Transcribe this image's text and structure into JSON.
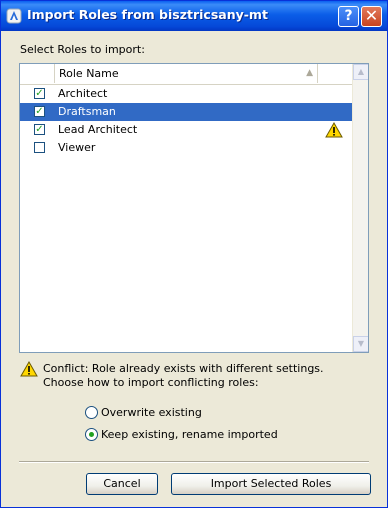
{
  "window": {
    "title": "Import Roles from bisztricsany-mt",
    "help_label": "?",
    "close_label": "✕"
  },
  "prompt": "Select Roles to import:",
  "table": {
    "header": "Role Name",
    "rows": [
      {
        "name": "Architect",
        "checked": true,
        "selected": false,
        "warning": false,
        "check_glyph": "✓"
      },
      {
        "name": "Draftsman",
        "checked": true,
        "selected": true,
        "warning": false,
        "check_glyph": "✓"
      },
      {
        "name": "Lead Architect",
        "checked": true,
        "selected": false,
        "warning": true,
        "check_glyph": "✓"
      },
      {
        "name": "Viewer",
        "checked": false,
        "selected": false,
        "warning": false,
        "check_glyph": ""
      }
    ]
  },
  "conflict": {
    "line1": "Conflict: Role already exists with different settings.",
    "line2": "Choose how to import conflicting roles:"
  },
  "options": {
    "overwrite": "Overwrite existing",
    "keep": "Keep existing, rename imported",
    "selected": "keep"
  },
  "buttons": {
    "cancel": "Cancel",
    "import": "Import Selected Roles"
  },
  "colors": {
    "selection": "#316ac5",
    "titlebar": "#0b5ee8",
    "warning": "#ffd700"
  }
}
